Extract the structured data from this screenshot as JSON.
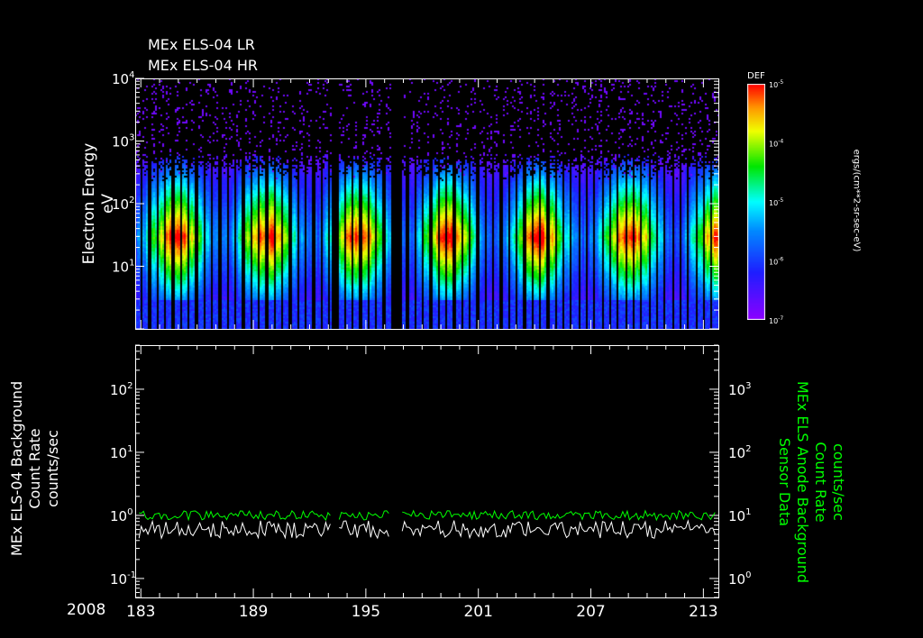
{
  "chart_data": [
    {
      "type": "heatmap",
      "titles": [
        "MEx ELS-04 LR",
        "MEx ELS-04 HR"
      ],
      "ylabel": "Electron Energy",
      "yunits": "eV",
      "yscale": "log",
      "ylim": [
        1,
        10000
      ],
      "yticks": [
        {
          "exp": "1",
          "label": "10"
        },
        {
          "exp": "2",
          "label": "10"
        },
        {
          "exp": "3",
          "label": "10"
        },
        {
          "exp": "4",
          "label": "10"
        }
      ],
      "xlim": [
        182.7,
        213.8
      ],
      "data_gaps": [
        [
          193.15,
          193.55
        ],
        [
          196.3,
          196.85
        ]
      ],
      "colorbar": {
        "label": "DEF",
        "units": "ergs/(cm**2-sr-sec-eV)",
        "range": [
          1e-07,
          1e-05
        ],
        "ticks": [
          {
            "b": "10",
            "e": "-5"
          },
          {
            "b": "10",
            "e": "-4"
          },
          {
            "b": "10",
            "e": "-5"
          },
          {
            "b": "10",
            "e": "-6"
          },
          {
            "b": "10",
            "e": "-7"
          }
        ]
      },
      "peak_energy_eV": 30,
      "upper_cutoff_eV": 400,
      "lower_cutoff_eV": 3
    },
    {
      "type": "line",
      "left_ylabel": [
        "MEx ELS-04 Background",
        "Count Rate",
        "counts/sec"
      ],
      "right_ylabel": [
        "Sensor Data",
        "MEx ELS Anode Background",
        "Count Rate",
        "counts/sec"
      ],
      "yscale": "log",
      "left_ylim": [
        0.05,
        500
      ],
      "right_ylim": [
        0.5,
        5000
      ],
      "left_yticks": [
        {
          "b": "10",
          "e": "2"
        },
        {
          "b": "10",
          "e": "1"
        },
        {
          "b": "10",
          "e": "0"
        },
        {
          "b": "10",
          "e": "-1"
        }
      ],
      "right_yticks": [
        {
          "b": "10",
          "e": "3"
        },
        {
          "b": "10",
          "e": "2"
        },
        {
          "b": "10",
          "e": "1"
        },
        {
          "b": "10",
          "e": "0"
        }
      ],
      "xlim": [
        182.7,
        213.8
      ],
      "series": [
        {
          "name": "MEx ELS-04 Background",
          "axis": "left",
          "color": "#ffffff",
          "mean": 0.6,
          "min": 0.4,
          "max": 0.9
        },
        {
          "name": "MEx ELS Anode Background",
          "axis": "right",
          "color": "#00ff00",
          "mean": 10,
          "min": 8.5,
          "max": 13
        }
      ]
    }
  ],
  "xaxis": {
    "year": "2008",
    "ticks": [
      "183",
      "189",
      "195",
      "201",
      "207",
      "213"
    ]
  },
  "colors": {
    "bg": "#000000",
    "axis": "#ffffff",
    "green": "#00ff00"
  }
}
